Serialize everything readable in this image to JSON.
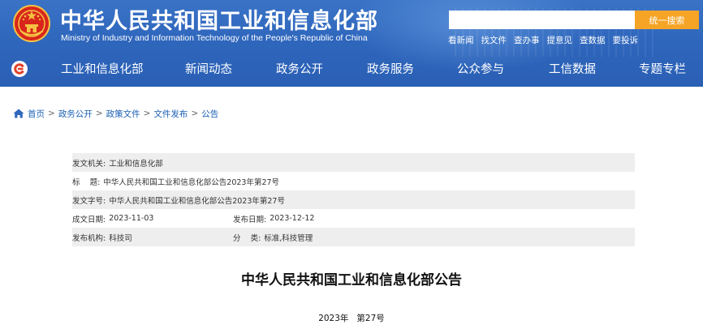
{
  "header": {
    "title": "中华人民共和国工业和信息化部",
    "subtitle": "Ministry of Industry and Information Technology of the People's Republic of China",
    "emblem_icon": "national-emblem-icon",
    "search": {
      "placeholder": "",
      "button_label": "统一搜索"
    },
    "quick_links": [
      "看新闻",
      "找文件",
      "查办事",
      "提意见",
      "查数据",
      "要投诉"
    ]
  },
  "nav": {
    "home_icon": "home-logo-icon",
    "items": [
      "工业和信息化部",
      "新闻动态",
      "政务公开",
      "政务服务",
      "公众参与",
      "工信数据",
      "专题专栏"
    ]
  },
  "breadcrumb": {
    "icon": "home-icon",
    "items": [
      "首页",
      "政务公开",
      "政策文件",
      "文件发布",
      "公告"
    ],
    "separator": ">"
  },
  "meta": {
    "issuer": {
      "label": "发文机关:",
      "value": "工业和信息化部"
    },
    "title": {
      "label": "标    题:",
      "value": "中华人民共和国工业和信息化部公告2023年第27号"
    },
    "doc_no": {
      "label": "发文字号:",
      "value": "中华人民共和国工业和信息化部公告2023年第27号"
    },
    "created": {
      "label": "成文日期:",
      "value": "2023-11-03"
    },
    "published": {
      "label": "发布日期:",
      "value": "2023-12-12"
    },
    "agency": {
      "label": "发布机构:",
      "value": "科技司"
    },
    "category": {
      "label": "分    类:",
      "value": "标准,科技管理"
    }
  },
  "document": {
    "heading": "中华人民共和国工业和信息化部公告",
    "number": "2023年   第27号"
  },
  "colors": {
    "header_blue": "#2f67bd",
    "search_orange": "#f6a426",
    "link_blue": "#1a5fb4",
    "row_gray": "#eeeeee"
  }
}
